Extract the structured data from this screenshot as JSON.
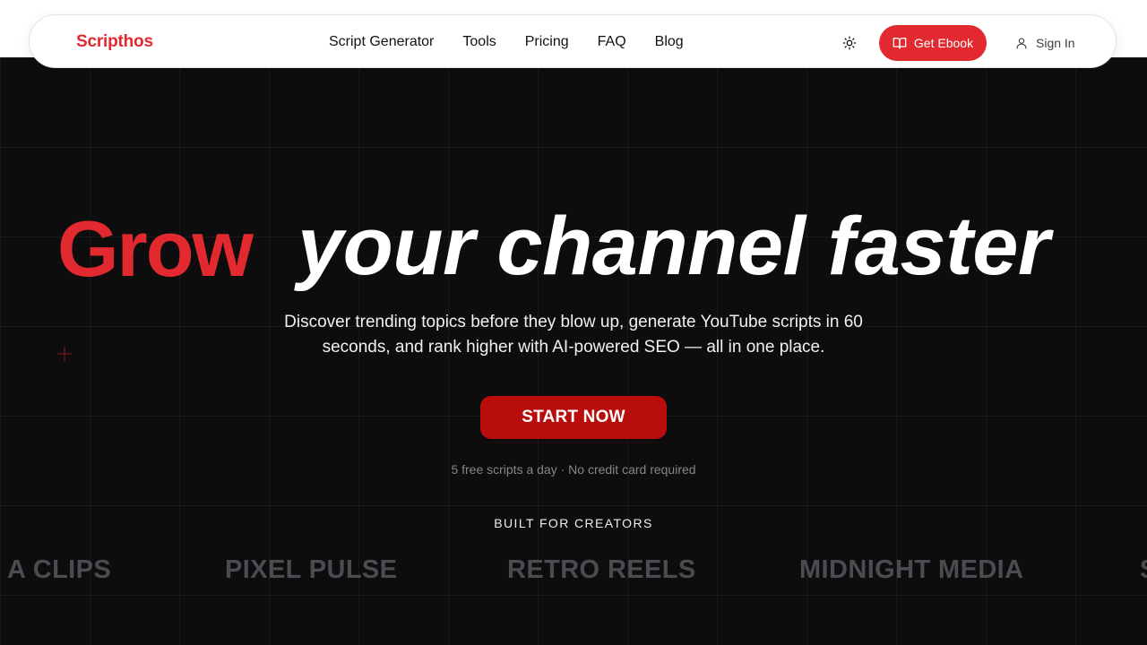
{
  "colors": {
    "brand_red": "#e2292f",
    "cta_red": "#b90d0d",
    "background": "#0d0d0e"
  },
  "navbar": {
    "logo": "Scripthos",
    "links": [
      "Script Generator",
      "Tools",
      "Pricing",
      "FAQ",
      "Blog"
    ],
    "theme_icon": "sun-icon",
    "ebook_label": "Get Ebook",
    "ebook_icon": "book-open-icon",
    "signin_label": "Sign In",
    "signin_icon": "user-icon"
  },
  "hero": {
    "title_highlight": "Grow",
    "title_rest": "your channel faster",
    "subtitle": "Discover trending topics before they blow up, generate YouTube scripts in 60 seconds, and rank higher with AI-powered SEO — all in one place.",
    "cta_label": "START NOW",
    "note": "5 free scripts a day · No credit card required"
  },
  "creators": {
    "heading": "BUILT FOR CREATORS",
    "brands": [
      "A CLIPS",
      "PIXEL PULSE",
      "RETRO REELS",
      "MIDNIGHT MEDIA",
      "S"
    ]
  }
}
